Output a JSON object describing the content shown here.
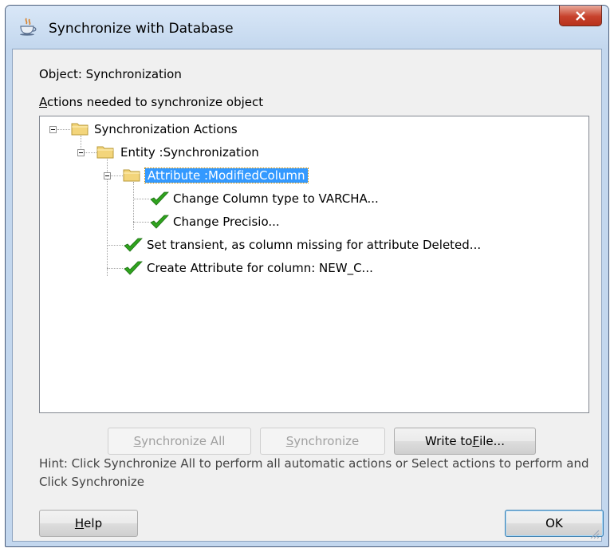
{
  "window": {
    "title": "Synchronize with Database",
    "app_icon": "java-cup-icon",
    "close_icon": "close-icon"
  },
  "labels": {
    "object": "Object: Synchronization",
    "actions_prefix": "A",
    "actions_rest": "ctions needed to synchronize object"
  },
  "tree": {
    "root": "Synchronization Actions",
    "entity": "Entity :Synchronization",
    "attribute": "Attribute :ModifiedColumn",
    "change_type": "Change Column type to VARCHA...",
    "change_precision": "Change Precisio...",
    "set_transient": "Set transient, as column missing for attribute Deleted...",
    "create_attribute": "Create Attribute for column: NEW_C..."
  },
  "buttons": {
    "sync_all_pre": "S",
    "sync_all_rest": "ynchronize All",
    "sync_pre": "S",
    "sync_rest": "ynchronize",
    "write_pre": "Write to ",
    "write_ul": "F",
    "write_post": "ile...",
    "help_ul": "H",
    "help_rest": "elp",
    "ok": "OK"
  },
  "hint": "Hint: Click Synchronize All to perform all automatic actions or Select actions to perform and Click Synchronize",
  "colors": {
    "selection": "#3399ff",
    "check": "#2fa31e",
    "folder": "#f3d57b"
  }
}
